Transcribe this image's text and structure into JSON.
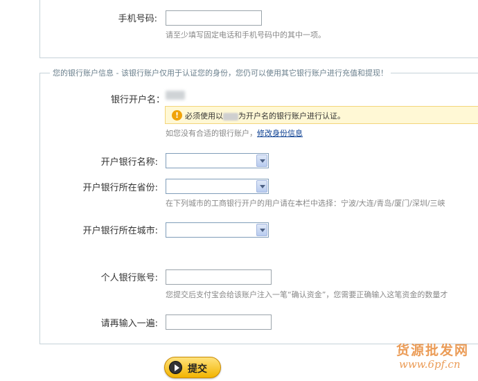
{
  "phone": {
    "label": "手机号码:",
    "value": "",
    "hint": "请至少填写固定电话和手机号码中的其中一项。"
  },
  "bank_section": {
    "legend": "您的银行账户信息 - 该银行账户仅用于认证您的身份，您仍可以使用其它银行账户进行充值和提现！",
    "account_name_label": "银行开户名：",
    "notice_prefix": "必须使用以",
    "notice_suffix": "为开户名的银行账户进行认证。",
    "no_account_text": "如您没有合适的银行账户，",
    "modify_link": "修改身份信息",
    "bank_name_label": "开户银行名称:",
    "bank_name_value": "",
    "province_label": "开户银行所在省份:",
    "province_value": "",
    "province_hint": "在下列城市的工商银行开户的用户请在本栏中选择：宁波/大连/青岛/厦门/深圳/三峡",
    "city_label": "开户银行所在城市:",
    "city_value": "",
    "account_label": "个人银行账号:",
    "account_value": "",
    "account_hint": "您提交后支付宝会给该账户注入一笔“确认资金”，您需要正确输入这笔资金的数量才",
    "confirm_label": "请再输入一遍:",
    "confirm_value": ""
  },
  "submit": {
    "label": "提交"
  },
  "watermark": {
    "text": "货源批发网",
    "url": "www.6pf.cn"
  },
  "colors": {
    "notice_bg": "#fff8d5",
    "warn": "#f0a30a",
    "link": "#0b3f91",
    "border": "#c6d2d9"
  }
}
